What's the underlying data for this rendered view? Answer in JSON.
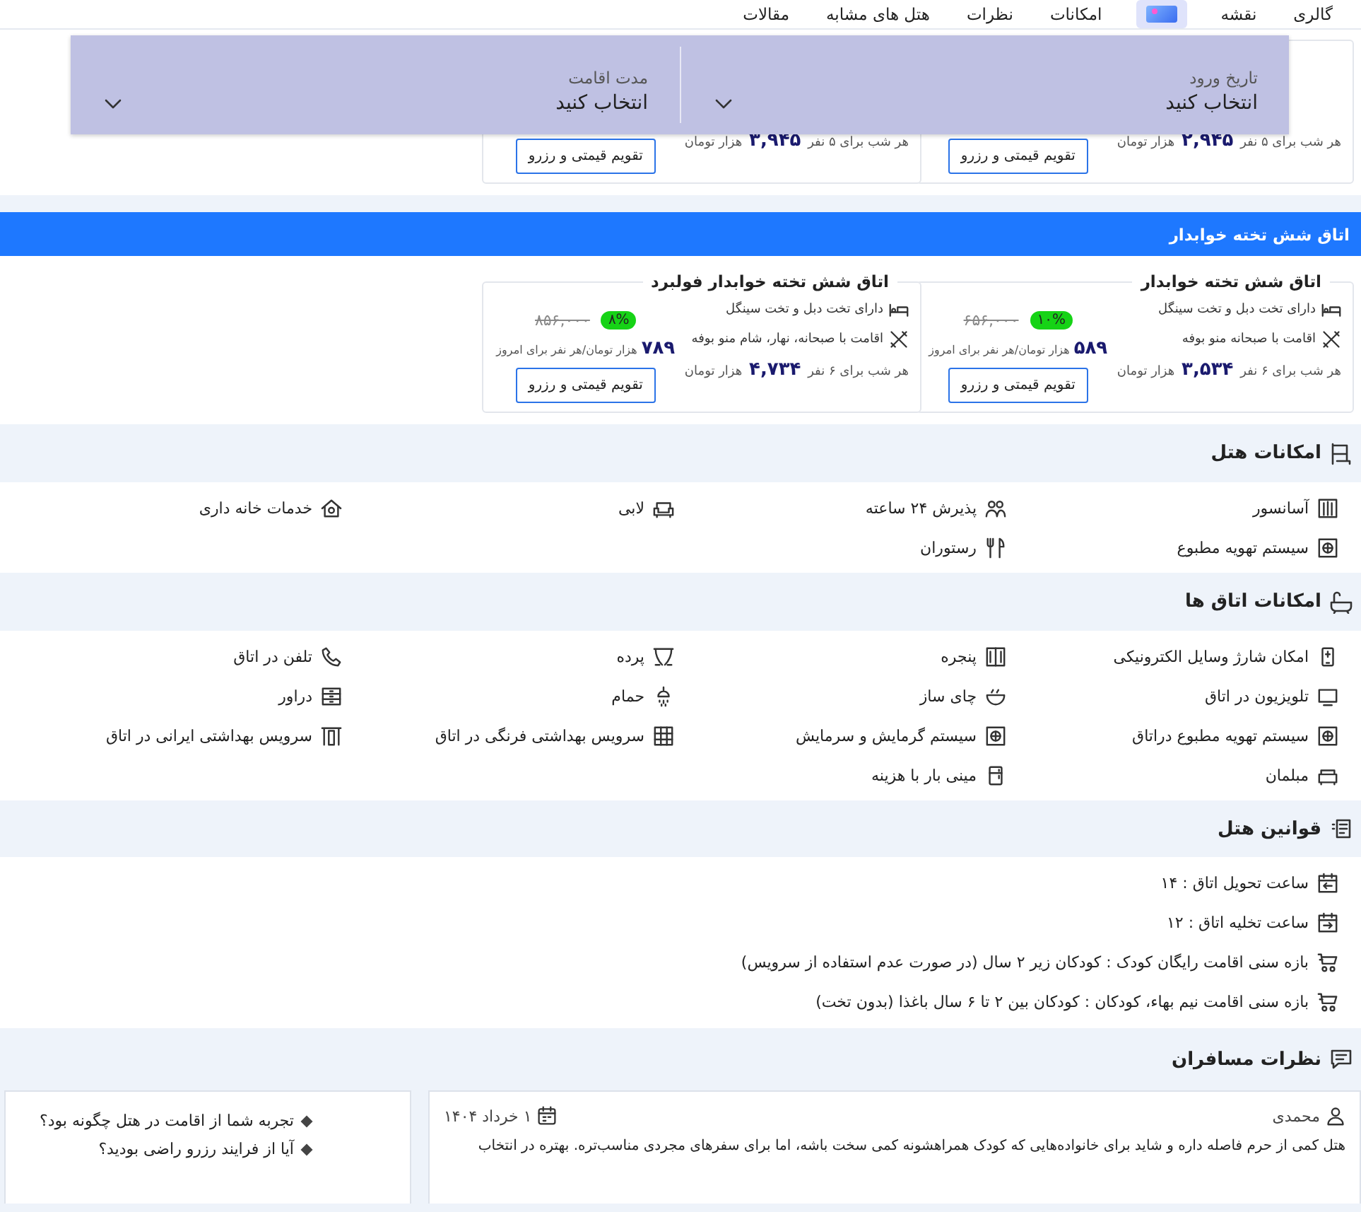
{
  "nav": {
    "tabs": [
      {
        "kind": "text",
        "label": "گالری",
        "selected": false
      },
      {
        "kind": "text",
        "label": "نقشه",
        "selected": false
      },
      {
        "kind": "icon",
        "selected": true
      },
      {
        "kind": "text",
        "label": "امکانات",
        "selected": false
      },
      {
        "kind": "text",
        "label": "نظرات",
        "selected": false
      },
      {
        "kind": "text",
        "label": "هتل های مشابه",
        "selected": false
      },
      {
        "kind": "text",
        "label": "مقالات",
        "selected": false
      }
    ]
  },
  "booking_bar": {
    "fields": [
      {
        "label": "تاریخ ورود",
        "value": "انتخاب کنید"
      },
      {
        "label": "مدت اقامت",
        "value": "انتخاب کنید"
      }
    ]
  },
  "room_groups": [
    {
      "cards": [
        {
          "nightly": "هر شب برای ۵ نفر",
          "total": "۲,۹۴۵",
          "unit": "هزار تومان",
          "button": "تقویم قیمتی و رزرو"
        },
        {
          "nightly": "هر شب برای ۵ نفر",
          "total": "۳,۹۴۵",
          "unit": "هزار تومان",
          "button": "تقویم قیمتی و رزرو"
        }
      ]
    },
    {
      "title": "اتاق شش تخته خوابدار",
      "cards": [
        {
          "title": "اتاق شش تخته خوابدار",
          "features": [
            {
              "kind": "bed",
              "text": "دارای تخت دبل و تخت سینگل"
            },
            {
              "kind": "meal",
              "text": "اقامت با صبحانه منو بوفه"
            }
          ],
          "old_price": "۶۵۶,۰۰۰",
          "discount": "۱۰%",
          "price": "۵۸۹",
          "price_unit": "هزار تومان/هر نفر برای امروز",
          "nightly": "هر شب برای ۶ نفر",
          "total": "۳,۵۳۴",
          "unit": "هزار تومان",
          "button": "تقویم قیمتی و رزرو"
        },
        {
          "title": "اتاق شش تخته خوابدار فولبرد",
          "features": [
            {
              "kind": "bed",
              "text": "دارای تخت دبل و تخت سینگل"
            },
            {
              "kind": "meal",
              "text": "اقامت با صبحانه، نهار، شام منو بوفه"
            }
          ],
          "old_price": "۸۵۶,۰۰۰",
          "discount": "۸%",
          "price": "۷۸۹",
          "price_unit": "هزار تومان/هر نفر برای امروز",
          "nightly": "هر شب برای ۶ نفر",
          "total": "۴,۷۳۴",
          "unit": "هزار تومان",
          "button": "تقویم قیمتی و رزرو"
        }
      ]
    }
  ],
  "sections": [
    {
      "kind": "hotel_amenities",
      "title": "امکانات هتل",
      "items": [
        {
          "kind": "elevator",
          "text": "آسانسور"
        },
        {
          "kind": "reception",
          "text": "پذیرش ۲۴ ساعته"
        },
        {
          "kind": "lobby",
          "text": "لابی"
        },
        {
          "kind": "housekeeping",
          "text": "خدمات خانه داری"
        },
        {
          "kind": "ac",
          "text": "سیستم تهویه مطبوع"
        },
        {
          "kind": "restaurant",
          "text": "رستوران"
        }
      ]
    },
    {
      "kind": "room_amenities",
      "title": "امکانات اتاق ها",
      "items": [
        {
          "kind": "charger",
          "text": "امکان شارژ وسایل الکترونیکی"
        },
        {
          "kind": "window",
          "text": "پنجره"
        },
        {
          "kind": "curtain",
          "text": "پرده"
        },
        {
          "kind": "phone",
          "text": "تلفن در اتاق"
        },
        {
          "kind": "tv",
          "text": "تلویزیون در اتاق"
        },
        {
          "kind": "kettle",
          "text": "چای ساز"
        },
        {
          "kind": "shower",
          "text": "حمام"
        },
        {
          "kind": "drawer",
          "text": "دراور"
        },
        {
          "kind": "ac",
          "text": "سیستم تهویه مطبوع دراتاق"
        },
        {
          "kind": "ac",
          "text": "سیستم گرمایش و سرمایش"
        },
        {
          "kind": "toilet",
          "text": "سرویس بهداشتی فرنگی در اتاق"
        },
        {
          "kind": "door",
          "text": "سرویس بهداشتی ایرانی در اتاق"
        },
        {
          "kind": "sofa",
          "text": "مبلمان"
        },
        {
          "kind": "fridge",
          "text": "مینی بار با هزینه"
        }
      ]
    },
    {
      "kind": "rules",
      "title": "قوانین هتل",
      "items": [
        {
          "kind": "checkin",
          "text": "ساعت تحویل اتاق : ۱۴"
        },
        {
          "kind": "checkout",
          "text": "ساعت تخلیه اتاق : ۱۲"
        },
        {
          "kind": "child",
          "text": "بازه سنی اقامت رایگان کودک : کودکان زیر ۲ سال (در صورت عدم استفاده از سرویس)"
        },
        {
          "kind": "child",
          "text": "بازه سنی اقامت نیم بهاء، کودکان : کودکان بین ۲ تا ۶ سال باغذا (بدون تخت)"
        }
      ]
    }
  ],
  "reviews": {
    "title": "نظرات مسافران",
    "comments": [
      {
        "author": "محمدی",
        "date": "۱ خرداد ۱۴۰۴",
        "text": "هتل کمی از حرم فاصله داره و شاید برای خانواده‌هایی که کودک همراهشونه کمی سخت باشه، اما برای سفرهای مجردی مناسب‌تره. بهتره در انتخاب"
      }
    ],
    "questions": [
      "تجربه شما از اقامت در هتل چگونه بود؟",
      "آیا از فرایند رزرو راضی بودید؟"
    ]
  }
}
